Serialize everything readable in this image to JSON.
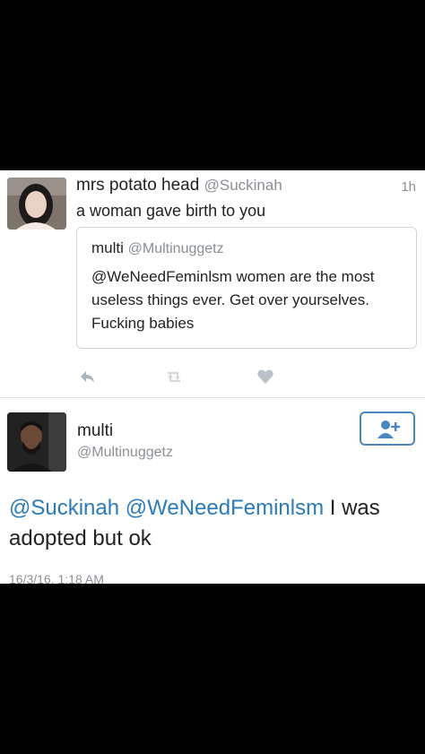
{
  "tweet": {
    "author_name": "mrs potato head",
    "author_handle": "@Suckinah",
    "time": "1h",
    "text": "a woman gave birth to you",
    "quoted": {
      "author_name": "multi",
      "author_handle": "@Multinuggetz",
      "text": "@WeNeedFeminlsm women are the most useless things ever. Get over yourselves. Fucking babies"
    },
    "actions": [
      "reply-icon",
      "retweet-icon",
      "like-icon"
    ]
  },
  "reply": {
    "author_name": "multi",
    "author_handle": "@Multinuggetz",
    "mention_1": "@Suckinah",
    "mention_2": "@WeNeedFeminlsm",
    "text": "I was adopted but ok",
    "date": "16/3/16, 1:18 AM",
    "follow_icon": "add-user-icon"
  },
  "colors": {
    "mention": "#2b7bb9",
    "follow_border": "#4a86c2",
    "muted": "#8a8f94",
    "like": "#b9c2cc"
  }
}
